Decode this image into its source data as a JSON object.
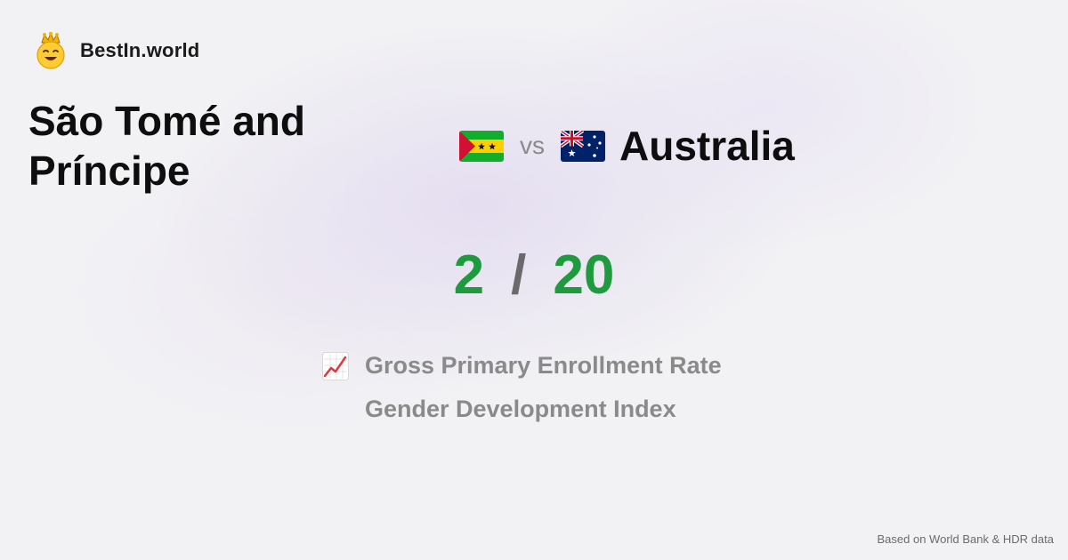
{
  "brand": {
    "name": "BestIn.world",
    "icon": "smiling-face-crown-icon"
  },
  "comparison": {
    "country_a": "São Tomé and Príncipe",
    "country_b": "Australia",
    "vs_label": "vs",
    "flag_a": "sao-tome-principe-flag-icon",
    "flag_b": "australia-flag-icon"
  },
  "score": {
    "value_a": "2",
    "separator": "/",
    "value_b": "20"
  },
  "metric": {
    "icon": "chart-increasing-icon",
    "line1": "Gross Primary Enrollment Rate",
    "line2": "Gender Development Index"
  },
  "footer": {
    "source": "Based on World Bank & HDR data"
  },
  "colors": {
    "score_green": "#1f9a3e",
    "muted_text": "#8a8a8a",
    "background": "#f2f2f4"
  }
}
